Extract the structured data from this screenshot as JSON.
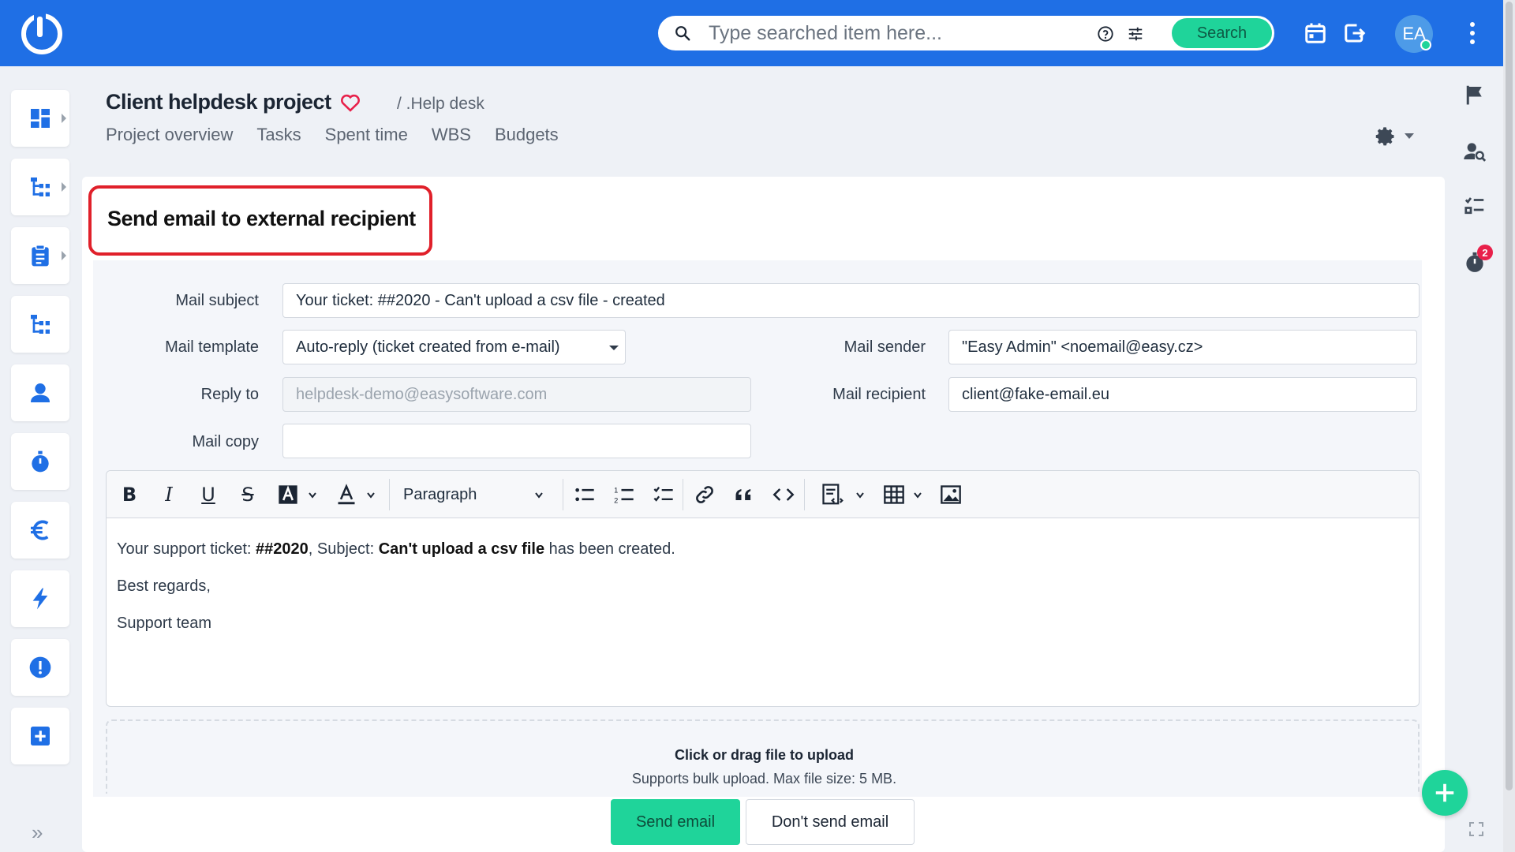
{
  "topbar": {
    "search_placeholder": "Type searched item here...",
    "search_button": "Search",
    "avatar_initials": "EA"
  },
  "header": {
    "project_title": "Client helpdesk project",
    "breadcrumb": "/ .Help desk",
    "nav": [
      "Project overview",
      "Tasks",
      "Spent time",
      "WBS",
      "Budgets"
    ]
  },
  "form": {
    "title": "Send email to external recipient",
    "mail_subject_label": "Mail subject",
    "mail_subject_value": "Your ticket: ##2020 - Can't upload a csv file - created",
    "mail_template_label": "Mail template",
    "mail_template_value": "Auto-reply (ticket created from e-mail)",
    "mail_sender_label": "Mail sender",
    "mail_sender_value": "\"Easy Admin\" <noemail@easy.cz>",
    "reply_to_label": "Reply to",
    "reply_to_value": "helpdesk-demo@easysoftware.com",
    "mail_recipient_label": "Mail recipient",
    "mail_recipient_value": "client@fake-email.eu",
    "mail_copy_label": "Mail copy",
    "mail_copy_value": ""
  },
  "editor": {
    "paragraph_style": "Paragraph",
    "line1_prefix": "Your support ticket: ",
    "line1_ticket": "##2020",
    "line1_mid": ", Subject: ",
    "line1_subject": "Can't upload a csv file",
    "line1_suffix": " has been created.",
    "line2": "Best regards,",
    "line3": "Support team"
  },
  "upload": {
    "title": "Click or drag file to upload",
    "subtitle": "Supports bulk upload. Max file size: 5 MB."
  },
  "actions": {
    "send": "Send email",
    "cancel": "Don't send email"
  },
  "right_sidebar": {
    "timer_badge": "2"
  },
  "sidebar": {
    "expand_glyph": "»"
  },
  "colors": {
    "topbar": "#1f6fe5",
    "accent_green": "#1fd49a",
    "highlight_red": "#e0202a",
    "icon_blue": "#1f6fe5"
  }
}
